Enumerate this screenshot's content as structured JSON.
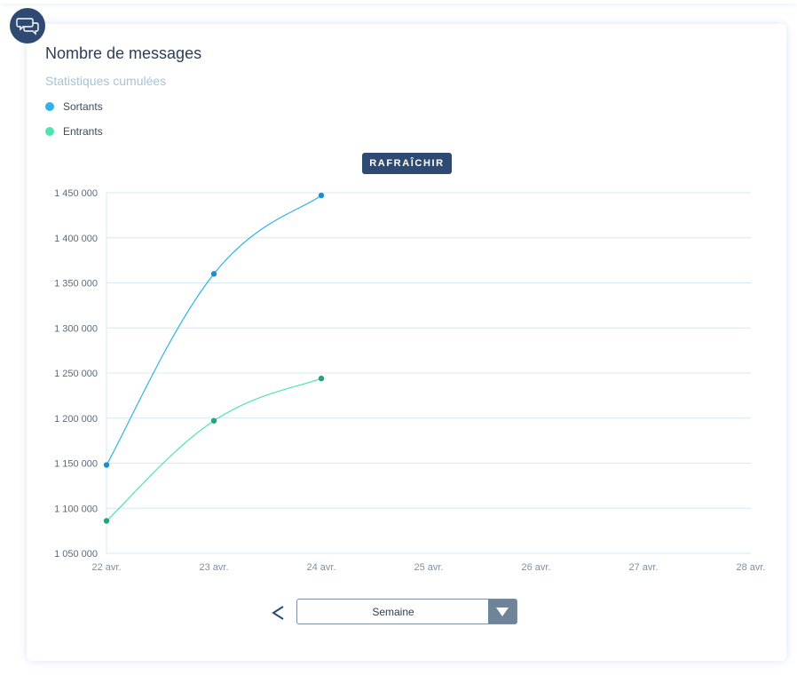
{
  "card": {
    "title": "Nombre de messages",
    "subtitle": "Statistiques cumulées",
    "badge_icon": "chat-bubbles-icon"
  },
  "refresh_button": {
    "label": "RAFRAÎCHIR"
  },
  "period": {
    "prev_icon": "chevron-left-icon",
    "selected": "Semaine",
    "dropdown_icon": "triangle-down-icon"
  },
  "colors": {
    "primary": "#2f4a72",
    "sortants": "#2bb3ea",
    "sortants_point": "#1d8fd0",
    "entrants": "#4fe3b0",
    "entrants_point": "#23a57a",
    "grid": "#d4e8f5"
  },
  "chart_data": {
    "type": "line",
    "title": "Nombre de messages",
    "subtitle": "Statistiques cumulées",
    "categories": [
      "22 avr.",
      "23 avr.",
      "24 avr.",
      "25 avr.",
      "26 avr.",
      "27 avr.",
      "28 avr."
    ],
    "series": [
      {
        "name": "Sortants",
        "values": [
          1148000,
          1360000,
          1447000
        ]
      },
      {
        "name": "Entrants",
        "values": [
          1086000,
          1197000,
          1244000
        ]
      }
    ],
    "yticks": [
      "1 050 000",
      "1 100 000",
      "1 150 000",
      "1 200 000",
      "1 250 000",
      "1 300 000",
      "1 350 000",
      "1 400 000",
      "1 450 000"
    ],
    "ylim": [
      1050000,
      1450000
    ],
    "grid": true,
    "legend": "top-left"
  }
}
